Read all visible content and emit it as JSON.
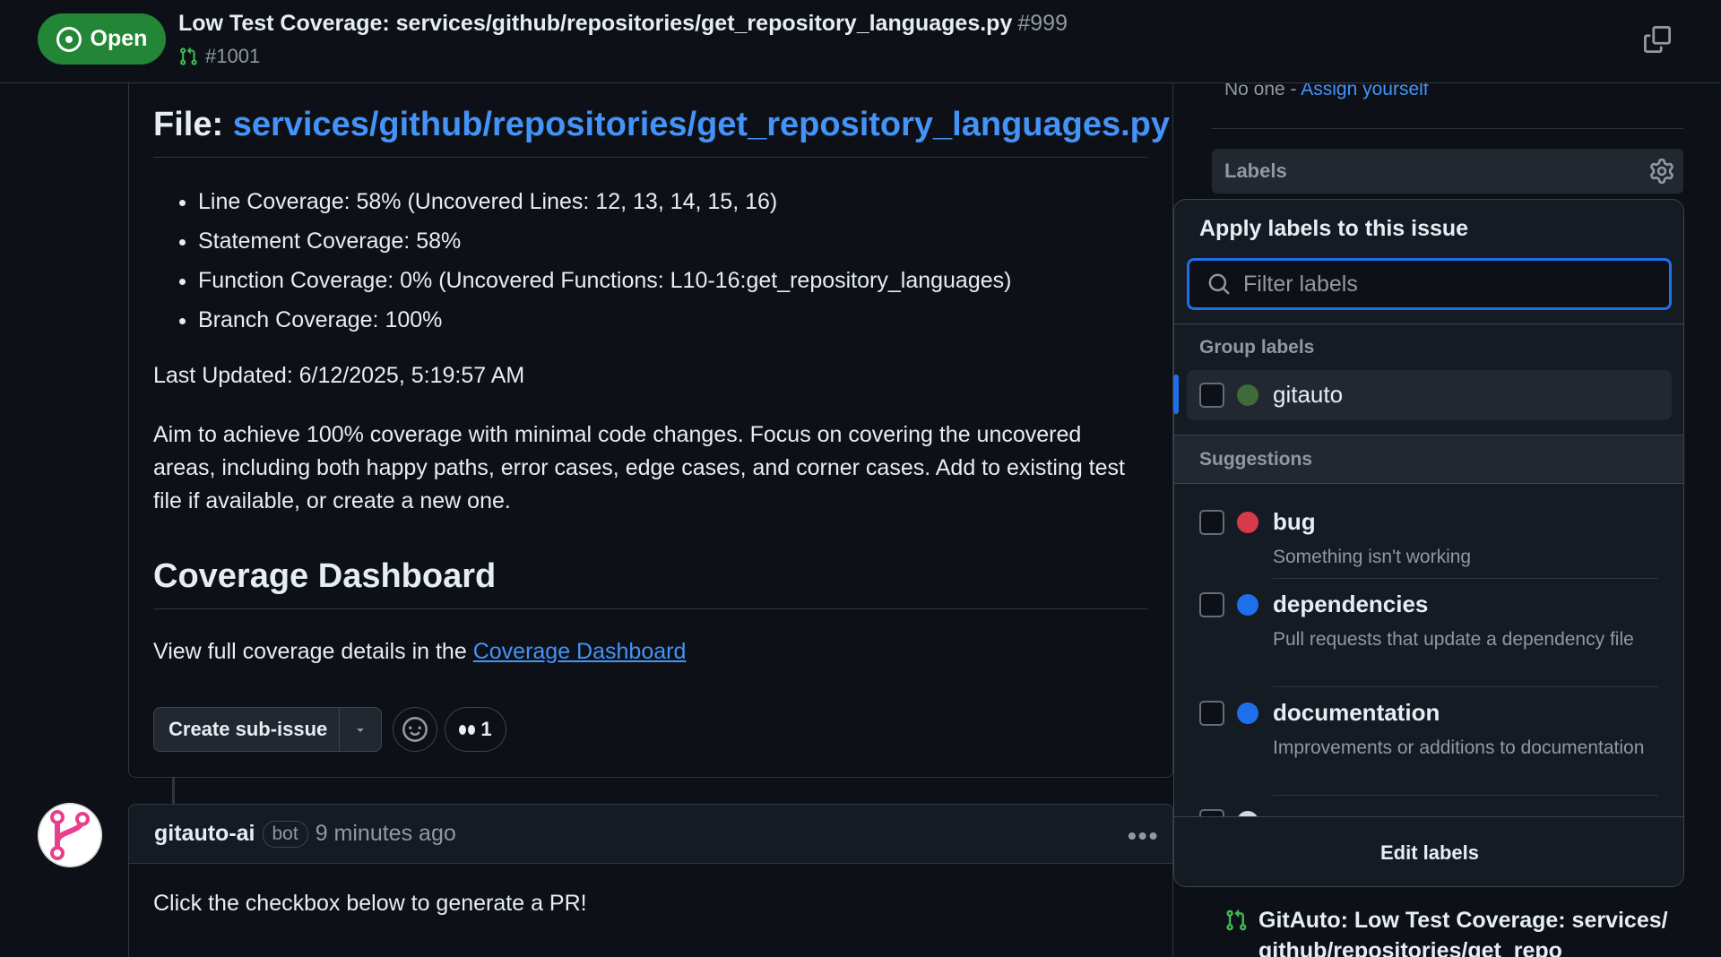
{
  "header": {
    "status": "Open",
    "title": "Low Test Coverage: services/github/repositories/get_repository_languages.py",
    "number": "#999",
    "linked_pr": "#1001"
  },
  "body": {
    "file_prefix": "File:",
    "file_link": "services/github/repositories/get_repository_languages.py",
    "bullets": [
      "Line Coverage: 58% (Uncovered Lines: 12, 13, 14, 15, 16)",
      "Statement Coverage: 58%",
      "Function Coverage: 0% (Uncovered Functions: L10-16:get_repository_languages)",
      "Branch Coverage: 100%"
    ],
    "last_updated": "Last Updated: 6/12/2025, 5:19:57 AM",
    "aim": "Aim to achieve 100% coverage with minimal code changes. Focus on covering the uncovered areas, including both happy paths, error cases, edge cases, and corner cases. Add to existing test file if available, or create a new one.",
    "dashboard_heading": "Coverage Dashboard",
    "dashboard_text": "View full coverage details in the",
    "dashboard_link": "Coverage Dashboard",
    "create_sub_issue": "Create sub-issue",
    "reaction_count": "1"
  },
  "comment": {
    "author": "gitauto-ai",
    "badge": "bot",
    "time": "9 minutes ago",
    "text": "Click the checkbox below to generate a PR!"
  },
  "sidebar": {
    "assignees_none": "No one -",
    "assign_yourself": "Assign yourself",
    "labels_heading": "Labels",
    "linked_pr_title": "GitAuto: Low Test Coverage: services/github/repositories/get_repo"
  },
  "label_picker": {
    "title": "Apply labels to this issue",
    "filter_placeholder": "Filter labels",
    "group_heading": "Group labels",
    "suggestions_heading": "Suggestions",
    "footer": "Edit labels",
    "group_labels": [
      {
        "name": "gitauto",
        "color": "#3f6b3a"
      }
    ],
    "suggestions": [
      {
        "name": "bug",
        "description": "Something isn't working",
        "color": "#d73a4a"
      },
      {
        "name": "dependencies",
        "description": "Pull requests that update a dependency file",
        "color": "#0366d6"
      },
      {
        "name": "documentation",
        "description": "Improvements or additions to documentation",
        "color": "#0075ca"
      }
    ]
  }
}
